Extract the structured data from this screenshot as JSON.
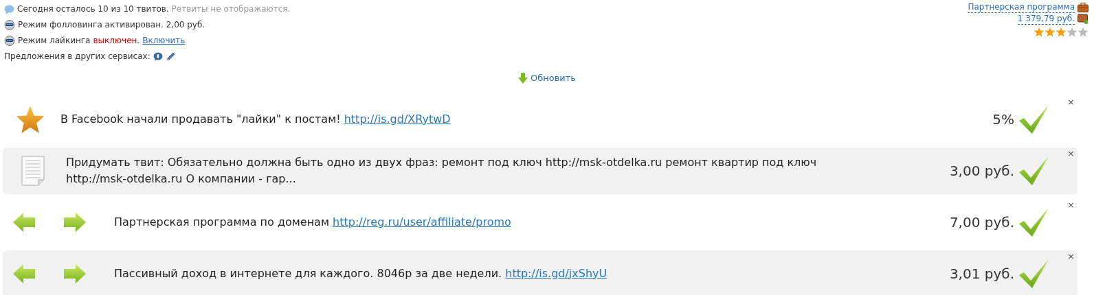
{
  "status_lines": [
    {
      "kind": "tweets",
      "text": "Сегодня осталось 10 из 10 твитов.",
      "note": "Ретвиты не отображаются."
    },
    {
      "kind": "following",
      "text": "Режим фолловинга активирован. 2,00 руб."
    },
    {
      "kind": "liking",
      "text": "Режим лайкинга",
      "state_label": "выключен",
      "enabled": false,
      "state_end": ".",
      "link": "Включить"
    },
    {
      "kind": "offers",
      "text": "Предложения в других сервисах:"
    }
  ],
  "account": {
    "partner_link": "Партнерская программа",
    "balance": "1 379,79 руб.",
    "stars": 3
  },
  "refresh_button": "Обновить",
  "tasks": [
    {
      "kind": "star",
      "text": "В Facebook начали продавать \"лайки\" к постам!",
      "link": "http://is.gd/XRytwD",
      "reward": "5%",
      "close": "×"
    },
    {
      "kind": "document",
      "text": "Придумать твит: Обязательно должна быть одно из двух фраз: ремонт под ключ http://msk-otdelka.ru ремонт квартир под ключ http://msk-otdelka.ru О компании - гар...",
      "reward": "3,00 руб.",
      "close": "×"
    },
    {
      "kind": "arrows",
      "text": "Партнерская программа по доменам",
      "link": "http://reg.ru/user/affiliate/promo",
      "reward": "7,00 руб.",
      "close": "×"
    },
    {
      "kind": "arrows",
      "text": "Пассивный доход в интернете для каждого. 8046р за две недели.",
      "link": "http://is.gd/jxShyU",
      "reward": "3,01 руб.",
      "close": "×"
    }
  ]
}
